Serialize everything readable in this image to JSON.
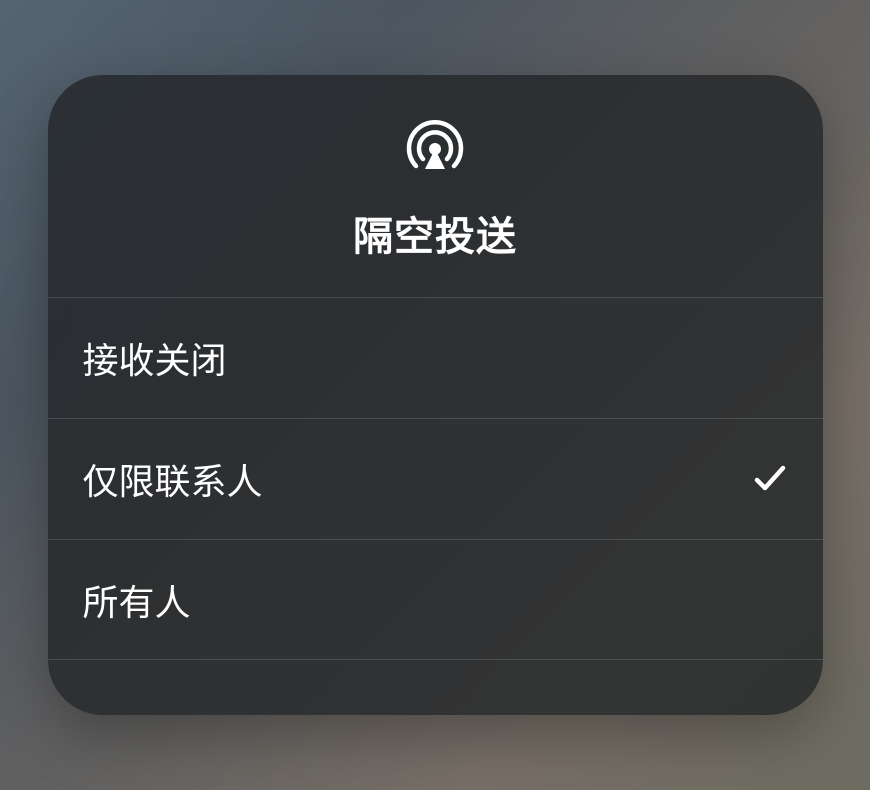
{
  "modal": {
    "title": "隔空投送",
    "icon": "airdrop-icon",
    "options": [
      {
        "label": "接收关闭",
        "selected": false
      },
      {
        "label": "仅限联系人",
        "selected": true
      },
      {
        "label": "所有人",
        "selected": false
      }
    ]
  }
}
